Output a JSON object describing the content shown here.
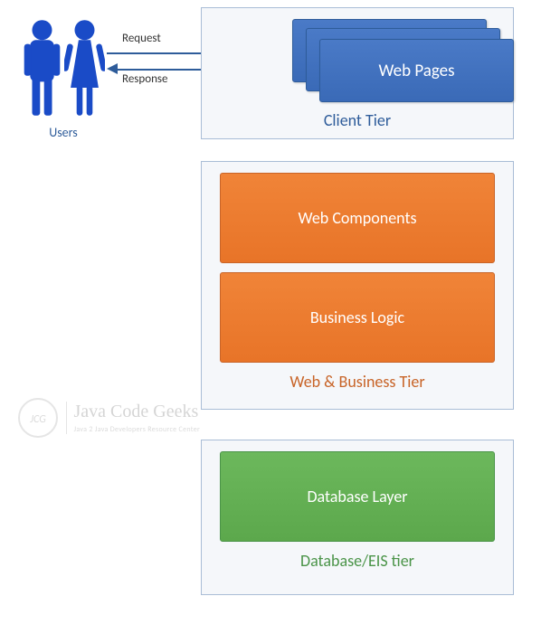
{
  "users": {
    "label": "Users"
  },
  "arrows": {
    "request_label": "Request",
    "response_label": "Response"
  },
  "tiers": {
    "client": {
      "label": "Client Tier",
      "component": "Web Pages"
    },
    "web_business": {
      "label": "Web & Business Tier",
      "component1": "Web Components",
      "component2": "Business Logic"
    },
    "database": {
      "label": "Database/EIS tier",
      "component": "Database Layer"
    }
  },
  "watermark": {
    "circle": "JCG",
    "title": "Java Code Geeks",
    "subtitle": "Java 2 Java Developers Resource Center"
  }
}
